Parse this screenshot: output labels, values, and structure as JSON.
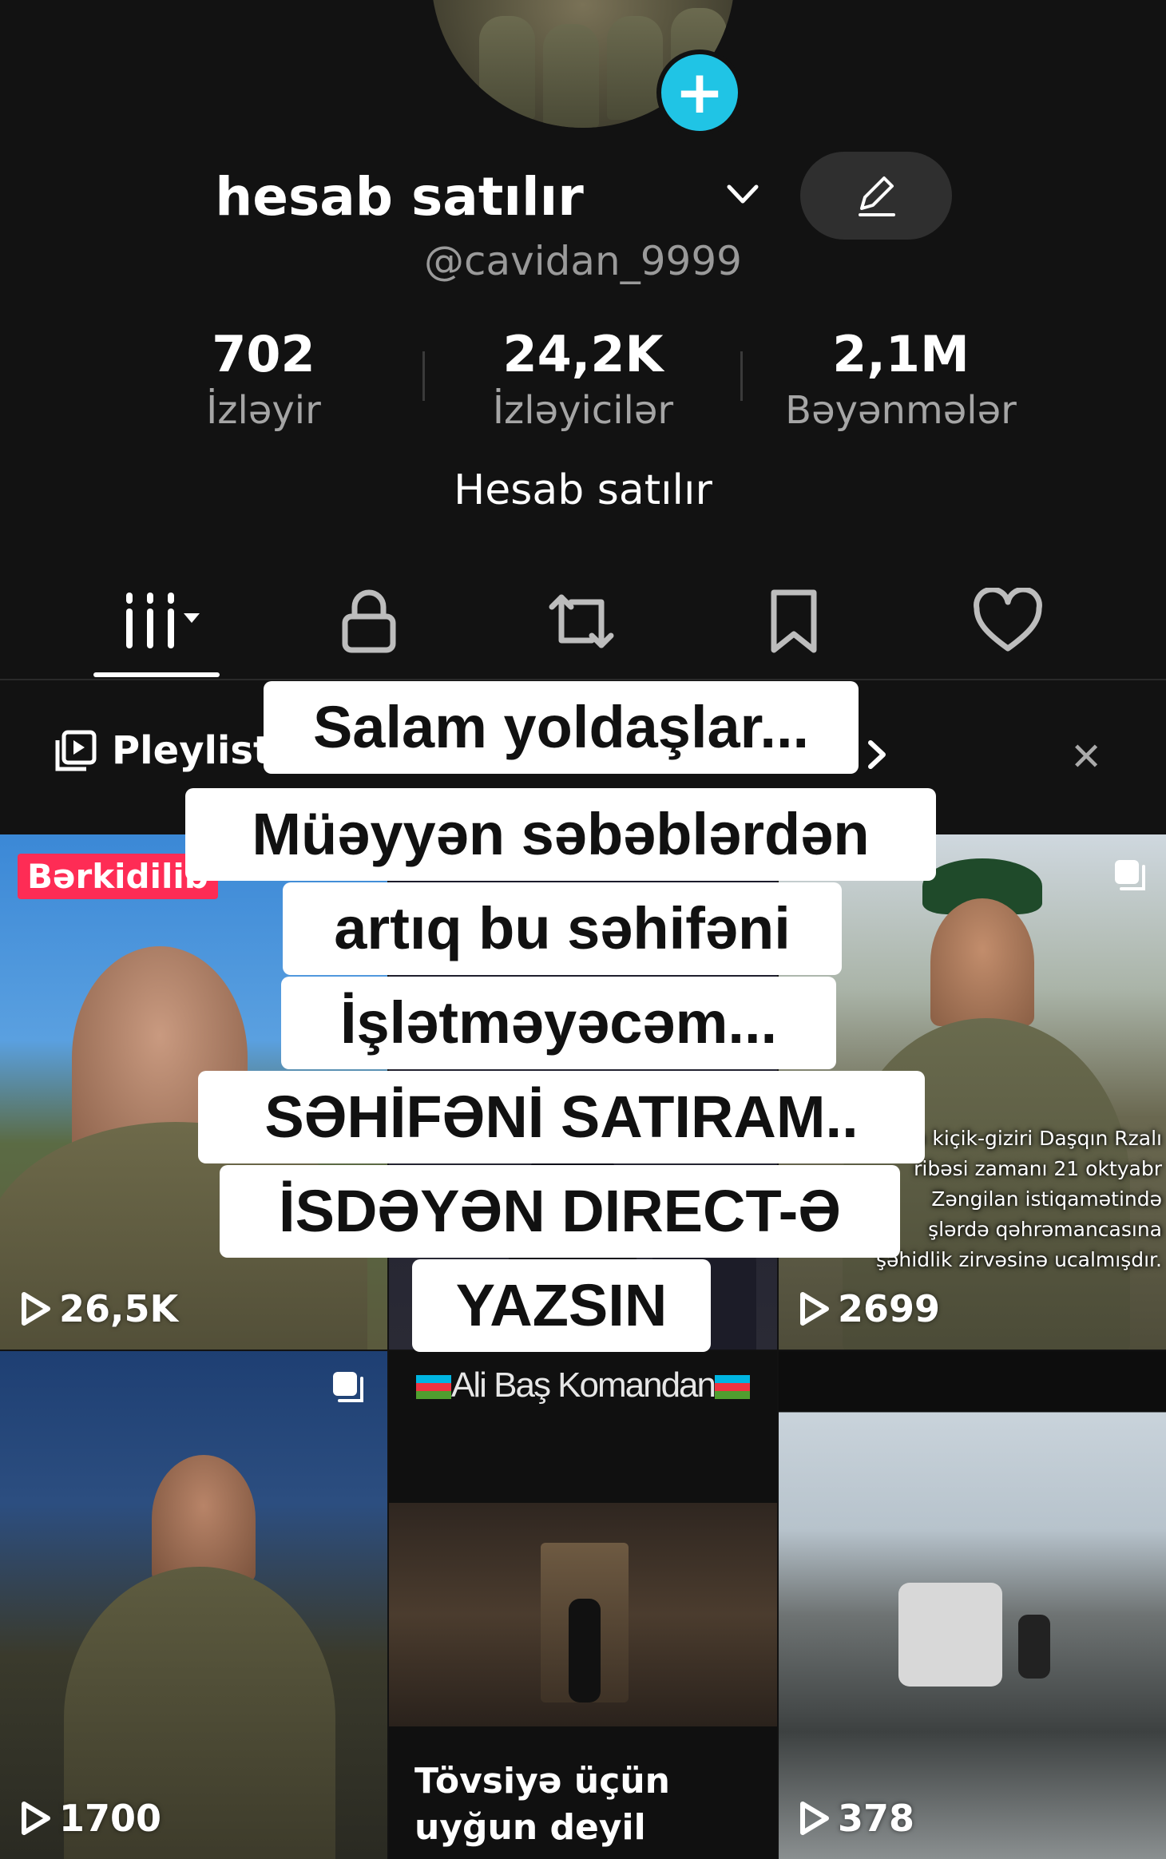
{
  "profile": {
    "display_name": "hesab satılır",
    "username": "@cavidan_9999",
    "bio": "Hesab satılır",
    "stats": [
      {
        "value": "702",
        "label": "İzləyir"
      },
      {
        "value": "24,2K",
        "label": "İzləyicilər"
      },
      {
        "value": "2,1M",
        "label": "Bəyənmələr"
      }
    ]
  },
  "tabs": [
    "videos-grid-icon",
    "lock-icon",
    "repost-icon",
    "bookmark-icon",
    "heart-icon"
  ],
  "playlist": {
    "label": "Pleylist"
  },
  "overlay_lines": [
    "Salam yoldaşlar...",
    "Müəyyən səbəblərdən",
    "artıq bu səhifəni",
    "İşlətməyəcəm...",
    "SƏHİFƏNİ SATIRAM..",
    "İSDƏYƏN DIRECT-Ə",
    "YAZSIN"
  ],
  "videos": [
    {
      "views": "26,5K",
      "badge": "Bərkidilib"
    },
    {
      "views": ""
    },
    {
      "views": "2699",
      "caption": "...n kiçik-giziri Daşqın Rzalı ...ibəsi zamanı 21 oktyabr ... Zəngilan istiqamətində ...şlərdə qəhrəmancasına şəhidlik zirvəsinə ucalmışdır.",
      "caption_lines": [
        "n kiçik-giziri Daşqın Rzalı",
        "ribəsi zamanı 21 oktyabr",
        "Zəngilan istiqamətində",
        "şlərdə qəhrəmancasına",
        "şəhidlik zirvəsinə ucalmışdır."
      ]
    },
    {
      "views": "1700"
    },
    {
      "title": "Ali Baş Komandan",
      "notice_line1": "Tövsiyə üçün",
      "notice_line2": "uyğun deyil"
    },
    {
      "views": "378"
    }
  ],
  "colors": {
    "accent_plus": "#20c4e5",
    "pin_badge": "#fe2c55",
    "background": "#121212"
  }
}
